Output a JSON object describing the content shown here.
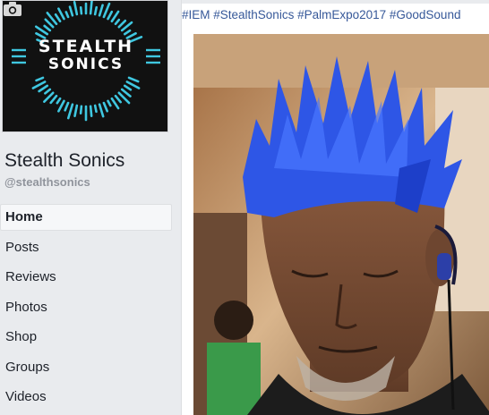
{
  "sidebar": {
    "logo": {
      "line1": "STEALTH",
      "line2": "SONICS"
    },
    "page_name": "Stealth Sonics",
    "page_handle": "@stealthsonics",
    "nav_items": [
      {
        "label": "Home",
        "active": true
      },
      {
        "label": "Posts",
        "active": false
      },
      {
        "label": "Reviews",
        "active": false
      },
      {
        "label": "Photos",
        "active": false
      },
      {
        "label": "Shop",
        "active": false
      },
      {
        "label": "Groups",
        "active": false
      },
      {
        "label": "Videos",
        "active": false
      }
    ]
  },
  "post": {
    "hashtags": "#IEM #StealthSonics #PalmExpo2017 #GoodSound"
  },
  "colors": {
    "link": "#365899",
    "page_bg": "#e9ebee",
    "logo_accent": "#3fc7e0",
    "hair": "#2e56e6"
  },
  "icons": [
    "camera-icon"
  ]
}
